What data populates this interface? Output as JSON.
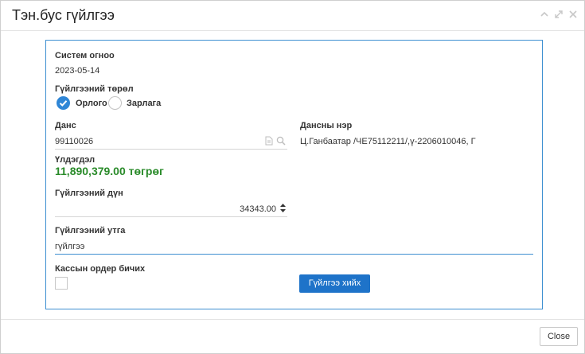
{
  "dialog": {
    "title": "Тэн.бус гүйлгээ",
    "icons": [
      "chevron-up-icon",
      "expand-icon",
      "close-icon"
    ]
  },
  "form": {
    "system_date_label": "Систем огноо",
    "system_date_value": "2023-05-14",
    "txn_type_label": "Гүйлгээний төрөл",
    "txn_type_options": [
      {
        "label": "Орлого",
        "selected": true
      },
      {
        "label": "Зарлага",
        "selected": false
      }
    ],
    "account_label": "Данс",
    "account_value": "99110026",
    "account_name_label": "Дансны нэр",
    "account_name_value": "Ц.Ганбаатар /ЧЕ75112211/,ү-2206010046, Г",
    "balance_label": "Үлдэгдэл",
    "balance_value": "11,890,379.00 төгрөг",
    "amount_label": "Гүйлгээний дүн",
    "amount_value": "34343.00",
    "description_label": "Гүйлгээний утга",
    "description_value": "гүйлгээ",
    "cash_order_label": "Кассын ордер бичих",
    "cash_order_checked": false,
    "submit_label": "Гүйлгээ хийх"
  },
  "footer": {
    "close_label": "Close"
  },
  "colors": {
    "accent": "#1e73c9",
    "panel_border": "#3d8fd1",
    "balance_green": "#2a8b2a"
  }
}
